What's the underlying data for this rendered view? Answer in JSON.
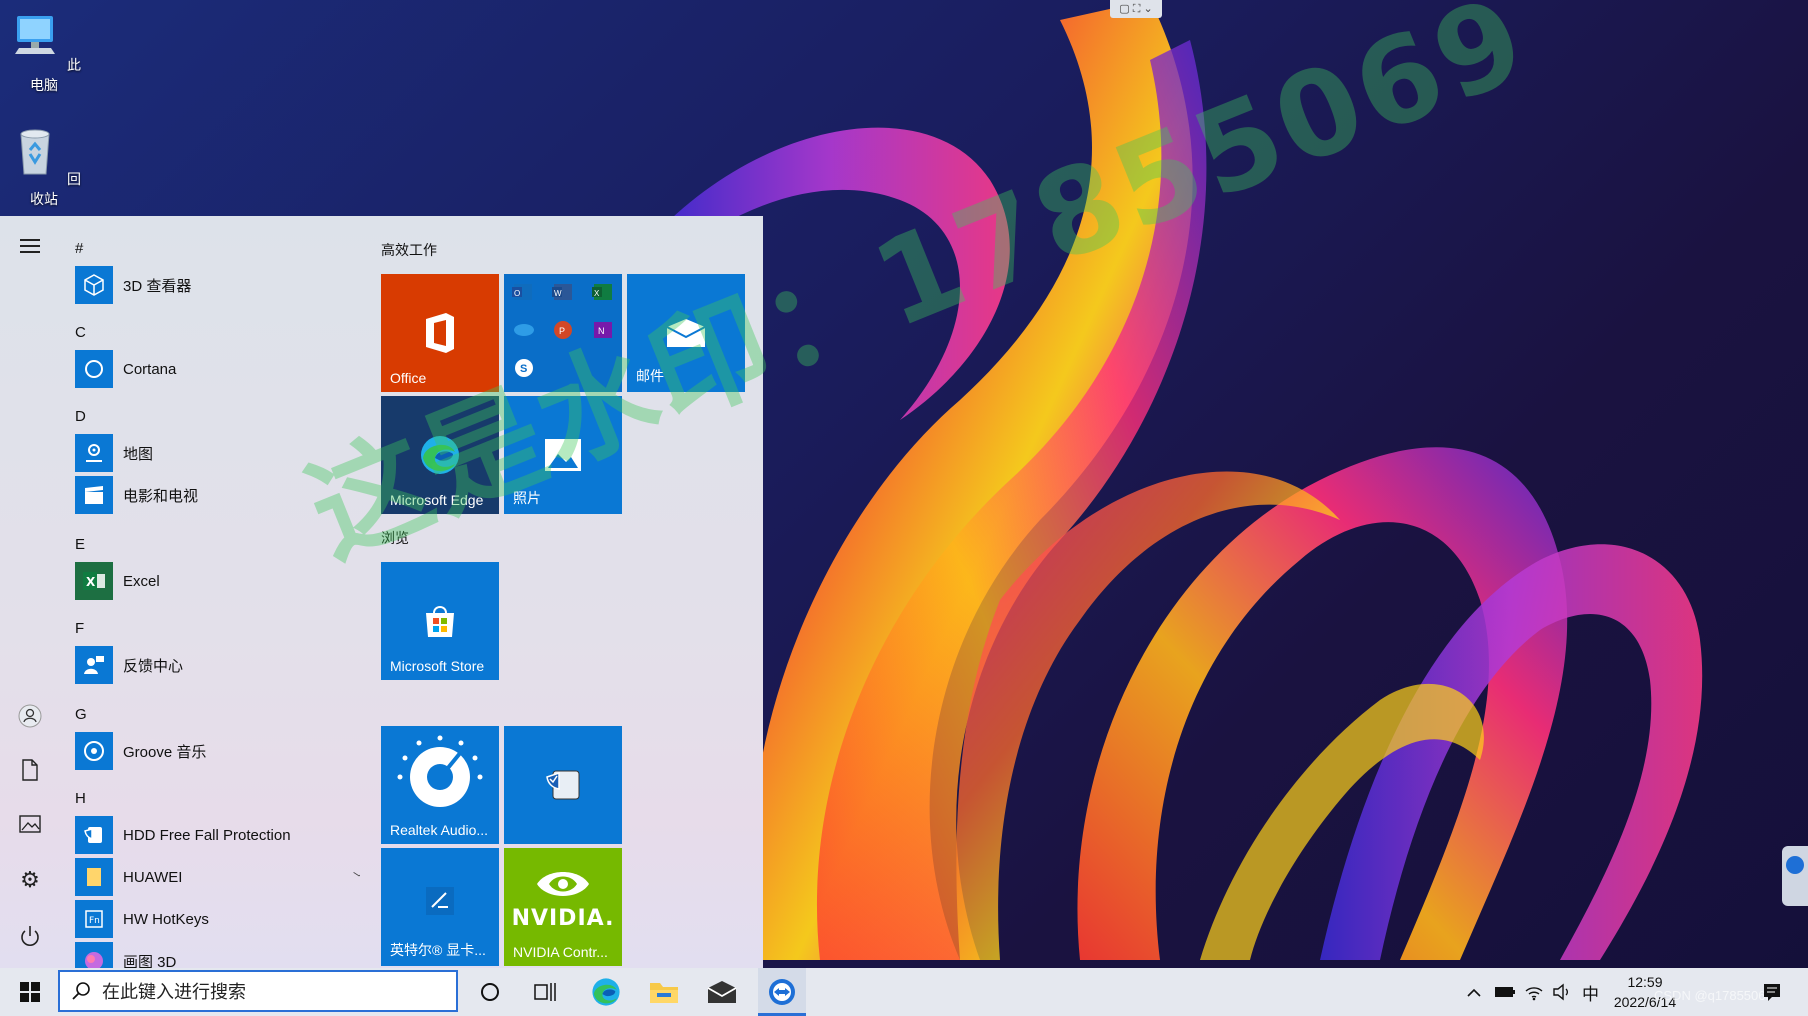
{
  "desktop": {
    "icons": [
      {
        "label": "此电脑",
        "icon": "computer-icon"
      },
      {
        "label": "回收站",
        "icon": "recycle-bin-icon"
      }
    ],
    "watermark": "这是水印：17855069"
  },
  "start_menu": {
    "app_list": [
      {
        "letter": "#"
      },
      {
        "label": "3D 查看器",
        "icon": "3d-viewer-icon"
      },
      {
        "letter": "C"
      },
      {
        "label": "Cortana",
        "icon": "cortana-icon"
      },
      {
        "letter": "D"
      },
      {
        "label": "地图",
        "icon": "maps-icon"
      },
      {
        "label": "电影和电视",
        "icon": "movies-tv-icon"
      },
      {
        "letter": "E"
      },
      {
        "label": "Excel",
        "icon": "excel-icon"
      },
      {
        "letter": "F"
      },
      {
        "label": "反馈中心",
        "icon": "feedback-hub-icon"
      },
      {
        "letter": "G"
      },
      {
        "label": "Groove 音乐",
        "icon": "groove-music-icon"
      },
      {
        "letter": "H"
      },
      {
        "label": "HDD Free Fall Protection",
        "icon": "hdd-protection-icon"
      },
      {
        "label": "HUAWEI",
        "icon": "folder-icon"
      },
      {
        "label": "HW HotKeys",
        "icon": "hotkeys-icon"
      },
      {
        "label": "画图 3D",
        "icon": "paint-3d-icon"
      }
    ],
    "groups": [
      {
        "title": "高效工作"
      },
      {
        "title": "浏览"
      }
    ],
    "tiles": [
      {
        "label": "Office",
        "color": "#d83b01",
        "icon": "office-icon"
      },
      {
        "label": "",
        "color": "#0a6ec8",
        "icon": "office-apps-icon"
      },
      {
        "label": "邮件",
        "color": "#0a78d4",
        "icon": "mail-icon"
      },
      {
        "label": "Microsoft Edge",
        "color": "#173a6b",
        "icon": "edge-icon"
      },
      {
        "label": "照片",
        "color": "#0a78d4",
        "icon": "photos-icon"
      },
      {
        "label": "Microsoft Store",
        "color": "#0a78d4",
        "icon": "store-icon"
      },
      {
        "label": "Realtek Audio...",
        "color": "#0a78d4",
        "icon": "realtek-audio-icon"
      },
      {
        "label": "",
        "color": "#0a78d4",
        "icon": "hdd-shield-icon"
      },
      {
        "label": "英特尔® 显卡...",
        "color": "#0a78d4",
        "icon": "intel-graphics-icon"
      },
      {
        "label": "NVIDIA Contr...",
        "color": "#76b900",
        "icon": "nvidia-icon"
      }
    ]
  },
  "taskbar": {
    "search_placeholder": "在此键入进行搜索",
    "ime": "中",
    "time": "12:59",
    "date": "2022/6/14",
    "csdn_mark": "CSDN @q17855069"
  }
}
